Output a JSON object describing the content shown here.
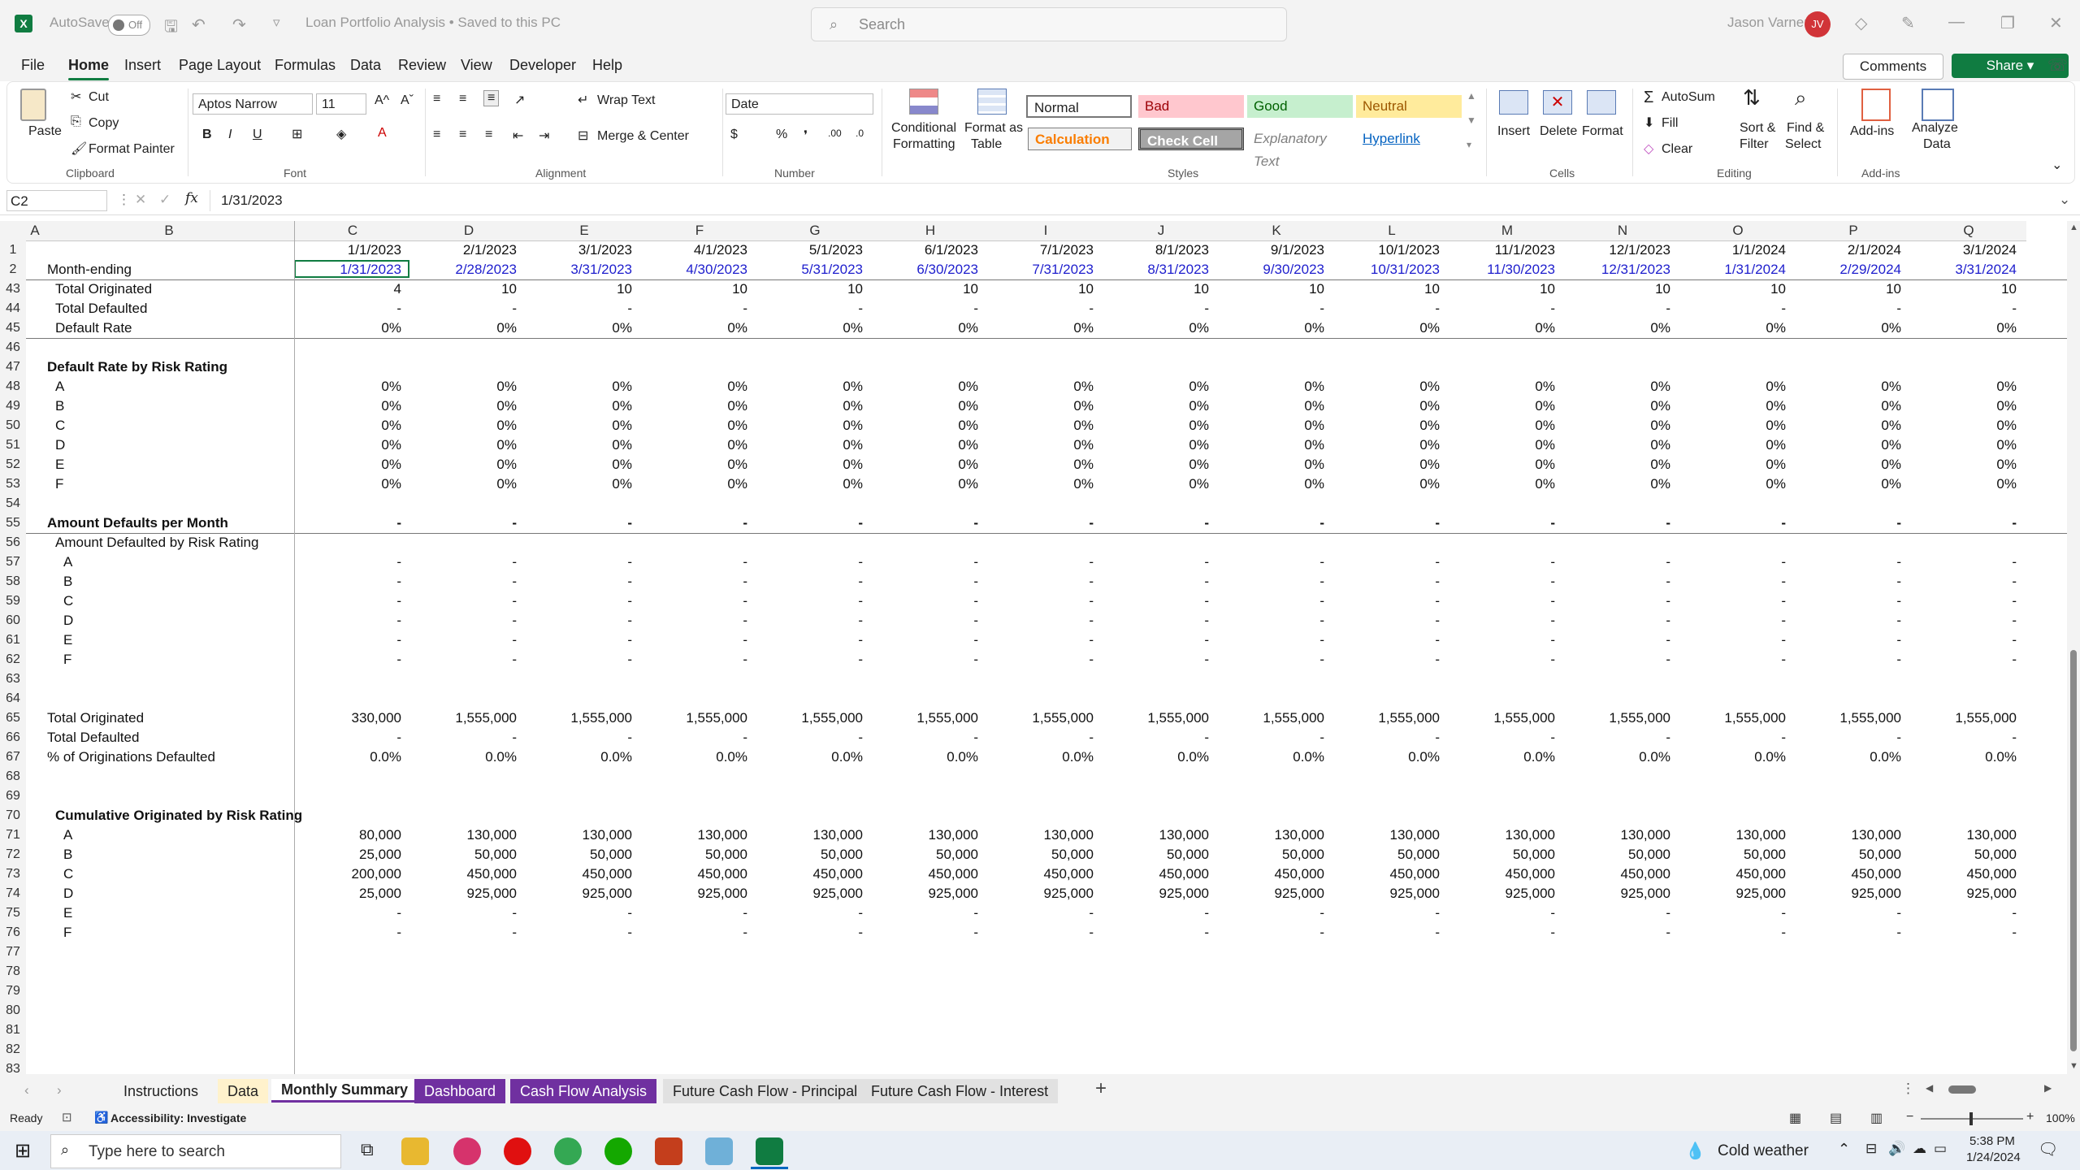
{
  "titlebar": {
    "autosave_label": "AutoSave",
    "autosave_state": "Off",
    "file_title": "Loan Portfolio Analysis • Saved to this PC",
    "search_placeholder": "Search",
    "user_name": "Jason Varner",
    "user_initials": "JV"
  },
  "menu": [
    "File",
    "Home",
    "Insert",
    "Page Layout",
    "Formulas",
    "Data",
    "Review",
    "View",
    "Developer",
    "Help"
  ],
  "menu_active": "Home",
  "actions": {
    "comments": "Comments",
    "share": "Share"
  },
  "ribbon": {
    "clipboard": {
      "paste": "Paste",
      "cut": "Cut",
      "copy": "Copy",
      "format_painter": "Format Painter",
      "group": "Clipboard"
    },
    "font": {
      "name": "Aptos Narrow",
      "size": "11",
      "group": "Font"
    },
    "alignment": {
      "wrap": "Wrap Text",
      "merge": "Merge & Center",
      "group": "Alignment"
    },
    "number": {
      "format": "Date",
      "group": "Number"
    },
    "styles": {
      "conditional": "Conditional",
      "conditional2": "Formatting",
      "format_table": "Format as",
      "format_table2": "Table",
      "normal": "Normal",
      "bad": "Bad",
      "good": "Good",
      "neutral": "Neutral",
      "calculation": "Calculation",
      "check_cell": "Check Cell",
      "explanatory": "Explanatory Text",
      "hyperlink": "Hyperlink",
      "group": "Styles"
    },
    "cells": {
      "insert": "Insert",
      "delete": "Delete",
      "format": "Format",
      "group": "Cells"
    },
    "editing": {
      "autosum": "AutoSum",
      "fill": "Fill",
      "clear": "Clear",
      "sort": "Sort &",
      "sort2": "Filter",
      "find": "Find &",
      "find2": "Select",
      "group": "Editing"
    },
    "addins": {
      "addins": "Add-ins",
      "analyze": "Analyze",
      "analyze2": "Data",
      "group": "Add-ins"
    }
  },
  "formula_bar": {
    "name_box": "C2",
    "formula": "1/31/2023"
  },
  "columns": [
    "A",
    "B",
    "C",
    "D",
    "E",
    "F",
    "G",
    "H",
    "I",
    "J",
    "K",
    "L",
    "M",
    "N",
    "O",
    "P",
    "Q"
  ],
  "sheet": {
    "row1": [
      "1/1/2023",
      "2/1/2023",
      "3/1/2023",
      "4/1/2023",
      "5/1/2023",
      "6/1/2023",
      "7/1/2023",
      "8/1/2023",
      "9/1/2023",
      "10/1/2023",
      "11/1/2023",
      "12/1/2023",
      "1/1/2024",
      "2/1/2024",
      "3/1/2024"
    ],
    "row2_label": "Month-ending",
    "row2": [
      "1/31/2023",
      "2/28/2023",
      "3/31/2023",
      "4/30/2023",
      "5/31/2023",
      "6/30/2023",
      "7/31/2023",
      "8/31/2023",
      "9/30/2023",
      "10/31/2023",
      "11/30/2023",
      "12/31/2023",
      "1/31/2024",
      "2/29/2024",
      "3/31/2024"
    ],
    "rows": [
      {
        "n": "43",
        "label": "Total Originated",
        "indent": 1,
        "vals": [
          "4",
          "10",
          "10",
          "10",
          "10",
          "10",
          "10",
          "10",
          "10",
          "10",
          "10",
          "10",
          "10",
          "10",
          "10"
        ]
      },
      {
        "n": "44",
        "label": "Total Defaulted",
        "indent": 1,
        "vals": [
          "-",
          "-",
          "-",
          "-",
          "-",
          "-",
          "-",
          "-",
          "-",
          "-",
          "-",
          "-",
          "-",
          "-",
          "-"
        ]
      },
      {
        "n": "45",
        "label": "Default Rate",
        "indent": 1,
        "vals": [
          "0%",
          "0%",
          "0%",
          "0%",
          "0%",
          "0%",
          "0%",
          "0%",
          "0%",
          "0%",
          "0%",
          "0%",
          "0%",
          "0%",
          "0%"
        ],
        "border_after": true
      },
      {
        "n": "46",
        "label": "",
        "vals": []
      },
      {
        "n": "47",
        "label": "Default Rate by Risk Rating",
        "bold": true,
        "vals": []
      },
      {
        "n": "48",
        "label": "A",
        "indent": 1,
        "vals": [
          "0%",
          "0%",
          "0%",
          "0%",
          "0%",
          "0%",
          "0%",
          "0%",
          "0%",
          "0%",
          "0%",
          "0%",
          "0%",
          "0%",
          "0%"
        ]
      },
      {
        "n": "49",
        "label": "B",
        "indent": 1,
        "vals": [
          "0%",
          "0%",
          "0%",
          "0%",
          "0%",
          "0%",
          "0%",
          "0%",
          "0%",
          "0%",
          "0%",
          "0%",
          "0%",
          "0%",
          "0%"
        ]
      },
      {
        "n": "50",
        "label": "C",
        "indent": 1,
        "vals": [
          "0%",
          "0%",
          "0%",
          "0%",
          "0%",
          "0%",
          "0%",
          "0%",
          "0%",
          "0%",
          "0%",
          "0%",
          "0%",
          "0%",
          "0%"
        ]
      },
      {
        "n": "51",
        "label": "D",
        "indent": 1,
        "vals": [
          "0%",
          "0%",
          "0%",
          "0%",
          "0%",
          "0%",
          "0%",
          "0%",
          "0%",
          "0%",
          "0%",
          "0%",
          "0%",
          "0%",
          "0%"
        ]
      },
      {
        "n": "52",
        "label": "E",
        "indent": 1,
        "vals": [
          "0%",
          "0%",
          "0%",
          "0%",
          "0%",
          "0%",
          "0%",
          "0%",
          "0%",
          "0%",
          "0%",
          "0%",
          "0%",
          "0%",
          "0%"
        ]
      },
      {
        "n": "53",
        "label": "F",
        "indent": 1,
        "vals": [
          "0%",
          "0%",
          "0%",
          "0%",
          "0%",
          "0%",
          "0%",
          "0%",
          "0%",
          "0%",
          "0%",
          "0%",
          "0%",
          "0%",
          "0%"
        ]
      },
      {
        "n": "54",
        "label": "",
        "vals": []
      },
      {
        "n": "55",
        "label": "Amount Defaults per Month",
        "bold": true,
        "vals": [
          "-",
          "-",
          "-",
          "-",
          "-",
          "-",
          "-",
          "-",
          "-",
          "-",
          "-",
          "-",
          "-",
          "-",
          "-"
        ],
        "bold_vals": true,
        "border_after": true
      },
      {
        "n": "56",
        "label": "Amount Defaulted by Risk Rating",
        "indent": 1,
        "vals": []
      },
      {
        "n": "57",
        "label": "A",
        "indent": 2,
        "vals": [
          "-",
          "-",
          "-",
          "-",
          "-",
          "-",
          "-",
          "-",
          "-",
          "-",
          "-",
          "-",
          "-",
          "-",
          "-"
        ]
      },
      {
        "n": "58",
        "label": "B",
        "indent": 2,
        "vals": [
          "-",
          "-",
          "-",
          "-",
          "-",
          "-",
          "-",
          "-",
          "-",
          "-",
          "-",
          "-",
          "-",
          "-",
          "-"
        ]
      },
      {
        "n": "59",
        "label": "C",
        "indent": 2,
        "vals": [
          "-",
          "-",
          "-",
          "-",
          "-",
          "-",
          "-",
          "-",
          "-",
          "-",
          "-",
          "-",
          "-",
          "-",
          "-"
        ]
      },
      {
        "n": "60",
        "label": "D",
        "indent": 2,
        "vals": [
          "-",
          "-",
          "-",
          "-",
          "-",
          "-",
          "-",
          "-",
          "-",
          "-",
          "-",
          "-",
          "-",
          "-",
          "-"
        ]
      },
      {
        "n": "61",
        "label": "E",
        "indent": 2,
        "vals": [
          "-",
          "-",
          "-",
          "-",
          "-",
          "-",
          "-",
          "-",
          "-",
          "-",
          "-",
          "-",
          "-",
          "-",
          "-"
        ]
      },
      {
        "n": "62",
        "label": "F",
        "indent": 2,
        "vals": [
          "-",
          "-",
          "-",
          "-",
          "-",
          "-",
          "-",
          "-",
          "-",
          "-",
          "-",
          "-",
          "-",
          "-",
          "-"
        ]
      },
      {
        "n": "63",
        "label": "",
        "vals": []
      },
      {
        "n": "64",
        "label": "",
        "vals": []
      },
      {
        "n": "65",
        "label": "Total Originated",
        "vals": [
          "330,000",
          "1,555,000",
          "1,555,000",
          "1,555,000",
          "1,555,000",
          "1,555,000",
          "1,555,000",
          "1,555,000",
          "1,555,000",
          "1,555,000",
          "1,555,000",
          "1,555,000",
          "1,555,000",
          "1,555,000",
          "1,555,000"
        ]
      },
      {
        "n": "66",
        "label": "Total Defaulted",
        "vals": [
          "-",
          "-",
          "-",
          "-",
          "-",
          "-",
          "-",
          "-",
          "-",
          "-",
          "-",
          "-",
          "-",
          "-",
          "-"
        ]
      },
      {
        "n": "67",
        "label": "% of Originations Defaulted",
        "vals": [
          "0.0%",
          "0.0%",
          "0.0%",
          "0.0%",
          "0.0%",
          "0.0%",
          "0.0%",
          "0.0%",
          "0.0%",
          "0.0%",
          "0.0%",
          "0.0%",
          "0.0%",
          "0.0%",
          "0.0%"
        ]
      },
      {
        "n": "68",
        "label": "",
        "vals": []
      },
      {
        "n": "69",
        "label": "",
        "vals": []
      },
      {
        "n": "70",
        "label": "Cumulative Originated by Risk Rating",
        "bold": true,
        "indent": 1,
        "vals": []
      },
      {
        "n": "71",
        "label": "A",
        "indent": 2,
        "vals": [
          "80,000",
          "130,000",
          "130,000",
          "130,000",
          "130,000",
          "130,000",
          "130,000",
          "130,000",
          "130,000",
          "130,000",
          "130,000",
          "130,000",
          "130,000",
          "130,000",
          "130,000"
        ]
      },
      {
        "n": "72",
        "label": "B",
        "indent": 2,
        "vals": [
          "25,000",
          "50,000",
          "50,000",
          "50,000",
          "50,000",
          "50,000",
          "50,000",
          "50,000",
          "50,000",
          "50,000",
          "50,000",
          "50,000",
          "50,000",
          "50,000",
          "50,000"
        ]
      },
      {
        "n": "73",
        "label": "C",
        "indent": 2,
        "vals": [
          "200,000",
          "450,000",
          "450,000",
          "450,000",
          "450,000",
          "450,000",
          "450,000",
          "450,000",
          "450,000",
          "450,000",
          "450,000",
          "450,000",
          "450,000",
          "450,000",
          "450,000"
        ]
      },
      {
        "n": "74",
        "label": "D",
        "indent": 2,
        "vals": [
          "25,000",
          "925,000",
          "925,000",
          "925,000",
          "925,000",
          "925,000",
          "925,000",
          "925,000",
          "925,000",
          "925,000",
          "925,000",
          "925,000",
          "925,000",
          "925,000",
          "925,000"
        ]
      },
      {
        "n": "75",
        "label": "E",
        "indent": 2,
        "vals": [
          "-",
          "-",
          "-",
          "-",
          "-",
          "-",
          "-",
          "-",
          "-",
          "-",
          "-",
          "-",
          "-",
          "-",
          "-"
        ]
      },
      {
        "n": "76",
        "label": "F",
        "indent": 2,
        "vals": [
          "-",
          "-",
          "-",
          "-",
          "-",
          "-",
          "-",
          "-",
          "-",
          "-",
          "-",
          "-",
          "-",
          "-",
          "-"
        ]
      },
      {
        "n": "77",
        "label": "",
        "vals": []
      },
      {
        "n": "78",
        "label": "",
        "vals": []
      },
      {
        "n": "79",
        "label": "",
        "vals": []
      },
      {
        "n": "80",
        "label": "",
        "vals": []
      },
      {
        "n": "81",
        "label": "",
        "vals": []
      },
      {
        "n": "82",
        "label": "",
        "vals": []
      },
      {
        "n": "83",
        "label": "",
        "vals": []
      }
    ]
  },
  "sheet_tabs": [
    {
      "label": "Instructions",
      "style": "plain"
    },
    {
      "label": "Data",
      "style": "yellow"
    },
    {
      "label": "Monthly Summary",
      "style": "active"
    },
    {
      "label": "Dashboard",
      "style": "purple"
    },
    {
      "label": "Cash Flow Analysis",
      "style": "purple"
    },
    {
      "label": "Future Cash Flow - Principal",
      "style": "gray"
    },
    {
      "label": "Future Cash Flow - Interest",
      "style": "gray"
    }
  ],
  "status": {
    "ready": "Ready",
    "accessibility": "Accessibility: Investigate",
    "zoom": "100%"
  },
  "taskbar": {
    "search_placeholder": "Type here to search",
    "weather": "Cold weather",
    "time": "5:38 PM",
    "date": "1/24/2024"
  },
  "colors": {
    "accent": "#107c41",
    "purple_tab": "#7030a0",
    "yellow_tab": "#fff2cc",
    "blue_date": "#1e1ecd"
  }
}
